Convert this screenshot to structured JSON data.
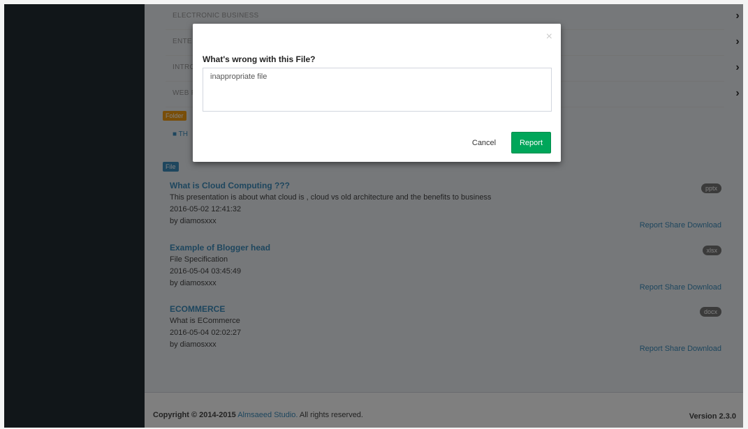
{
  "categories": [
    {
      "label": "ELECTRONIC BUSINESS"
    },
    {
      "label": "ENTE"
    },
    {
      "label": "INTRO"
    },
    {
      "label": "WEB P"
    }
  ],
  "folder_section": {
    "badge": "Folder",
    "folder_link": "TH"
  },
  "file_section": {
    "badge": "File",
    "items": [
      {
        "title": "What is Cloud Computing ???",
        "description": "This presentation is about what cloud is , cloud vs old architecture and the benefits to business",
        "date": "2016-05-02 12:41:32",
        "owner": "by diamosxxx",
        "ext": "pptx",
        "report": "Report",
        "share": "Share",
        "download": "Download"
      },
      {
        "title": "Example of Blogger head",
        "description": "File Specification",
        "date": "2016-05-04 03:45:49",
        "owner": "by diamosxxx",
        "ext": "xlsx",
        "report": "Report",
        "share": "Share",
        "download": "Download"
      },
      {
        "title": "ECOMMERCE",
        "description": "What is ECommerce",
        "date": "2016-05-04 02:02:27",
        "owner": "by diamosxxx",
        "ext": "docx",
        "report": "Report",
        "share": "Share",
        "download": "Download"
      }
    ]
  },
  "footer": {
    "copyright_prefix": "Copyright © 2014-2015",
    "company": "Almsaeed Studio.",
    "rights": "All rights reserved.",
    "version": "Version 2.3.0"
  },
  "modal": {
    "question": "What's wrong with this File?",
    "textarea_value": "inappropriate file",
    "cancel_label": "Cancel",
    "report_label": "Report",
    "close_glyph": "×"
  },
  "colors": {
    "sidebar": "#222d32",
    "primary": "#3c8dbc",
    "success": "#00a65a",
    "warning": "#f39c12"
  }
}
